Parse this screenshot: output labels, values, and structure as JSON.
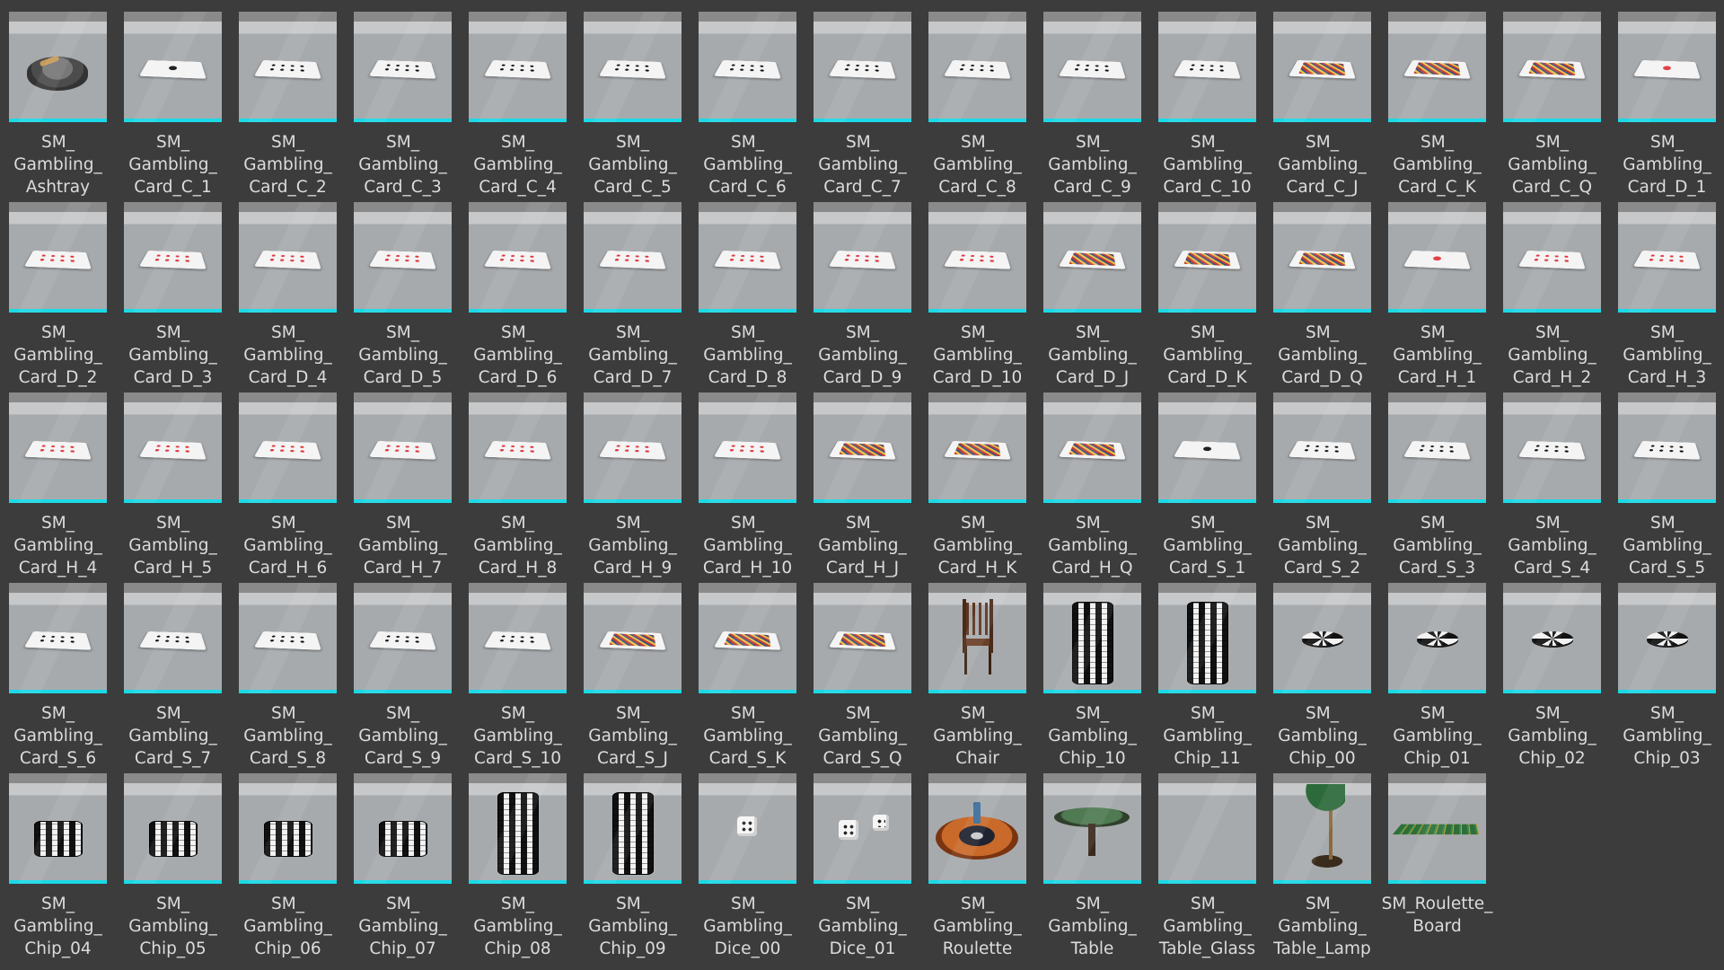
{
  "bar_color": "#1bd9e6",
  "background": "#3c3c3c",
  "assets": [
    {
      "label": "SM_\nGambling_\nAshtray",
      "icon": "ashtray"
    },
    {
      "label": "SM_\nGambling_\nCard_C_1",
      "icon": "card-club-ace"
    },
    {
      "label": "SM_\nGambling_\nCard_C_2",
      "icon": "card-club"
    },
    {
      "label": "SM_\nGambling_\nCard_C_3",
      "icon": "card-club"
    },
    {
      "label": "SM_\nGambling_\nCard_C_4",
      "icon": "card-club"
    },
    {
      "label": "SM_\nGambling_\nCard_C_5",
      "icon": "card-club"
    },
    {
      "label": "SM_\nGambling_\nCard_C_6",
      "icon": "card-club"
    },
    {
      "label": "SM_\nGambling_\nCard_C_7",
      "icon": "card-club"
    },
    {
      "label": "SM_\nGambling_\nCard_C_8",
      "icon": "card-club"
    },
    {
      "label": "SM_\nGambling_\nCard_C_9",
      "icon": "card-club"
    },
    {
      "label": "SM_\nGambling_\nCard_C_10",
      "icon": "card-club"
    },
    {
      "label": "SM_\nGambling_\nCard_C_J",
      "icon": "card-face"
    },
    {
      "label": "SM_\nGambling_\nCard_C_K",
      "icon": "card-face"
    },
    {
      "label": "SM_\nGambling_\nCard_C_Q",
      "icon": "card-face"
    },
    {
      "label": "SM_\nGambling_\nCard_D_1",
      "icon": "card-diamond-ace"
    },
    {
      "label": "SM_\nGambling_\nCard_D_2",
      "icon": "card-diamond"
    },
    {
      "label": "SM_\nGambling_\nCard_D_3",
      "icon": "card-diamond"
    },
    {
      "label": "SM_\nGambling_\nCard_D_4",
      "icon": "card-diamond"
    },
    {
      "label": "SM_\nGambling_\nCard_D_5",
      "icon": "card-diamond"
    },
    {
      "label": "SM_\nGambling_\nCard_D_6",
      "icon": "card-diamond"
    },
    {
      "label": "SM_\nGambling_\nCard_D_7",
      "icon": "card-diamond"
    },
    {
      "label": "SM_\nGambling_\nCard_D_8",
      "icon": "card-diamond"
    },
    {
      "label": "SM_\nGambling_\nCard_D_9",
      "icon": "card-diamond"
    },
    {
      "label": "SM_\nGambling_\nCard_D_10",
      "icon": "card-diamond"
    },
    {
      "label": "SM_\nGambling_\nCard_D_J",
      "icon": "card-face"
    },
    {
      "label": "SM_\nGambling_\nCard_D_K",
      "icon": "card-face"
    },
    {
      "label": "SM_\nGambling_\nCard_D_Q",
      "icon": "card-face"
    },
    {
      "label": "SM_\nGambling_\nCard_H_1",
      "icon": "card-heart-ace"
    },
    {
      "label": "SM_\nGambling_\nCard_H_2",
      "icon": "card-heart"
    },
    {
      "label": "SM_\nGambling_\nCard_H_3",
      "icon": "card-heart"
    },
    {
      "label": "SM_\nGambling_\nCard_H_4",
      "icon": "card-heart"
    },
    {
      "label": "SM_\nGambling_\nCard_H_5",
      "icon": "card-heart"
    },
    {
      "label": "SM_\nGambling_\nCard_H_6",
      "icon": "card-heart"
    },
    {
      "label": "SM_\nGambling_\nCard_H_7",
      "icon": "card-heart"
    },
    {
      "label": "SM_\nGambling_\nCard_H_8",
      "icon": "card-heart"
    },
    {
      "label": "SM_\nGambling_\nCard_H_9",
      "icon": "card-heart"
    },
    {
      "label": "SM_\nGambling_\nCard_H_10",
      "icon": "card-heart"
    },
    {
      "label": "SM_\nGambling_\nCard_H_J",
      "icon": "card-face"
    },
    {
      "label": "SM_\nGambling_\nCard_H_K",
      "icon": "card-face"
    },
    {
      "label": "SM_\nGambling_\nCard_H_Q",
      "icon": "card-face"
    },
    {
      "label": "SM_\nGambling_\nCard_S_1",
      "icon": "card-spade-ace"
    },
    {
      "label": "SM_\nGambling_\nCard_S_2",
      "icon": "card-spade"
    },
    {
      "label": "SM_\nGambling_\nCard_S_3",
      "icon": "card-spade"
    },
    {
      "label": "SM_\nGambling_\nCard_S_4",
      "icon": "card-spade"
    },
    {
      "label": "SM_\nGambling_\nCard_S_5",
      "icon": "card-spade"
    },
    {
      "label": "SM_\nGambling_\nCard_S_6",
      "icon": "card-spade"
    },
    {
      "label": "SM_\nGambling_\nCard_S_7",
      "icon": "card-spade"
    },
    {
      "label": "SM_\nGambling_\nCard_S_8",
      "icon": "card-spade"
    },
    {
      "label": "SM_\nGambling_\nCard_S_9",
      "icon": "card-spade"
    },
    {
      "label": "SM_\nGambling_\nCard_S_10",
      "icon": "card-spade"
    },
    {
      "label": "SM_\nGambling_\nCard_S_J",
      "icon": "card-face"
    },
    {
      "label": "SM_\nGambling_\nCard_S_K",
      "icon": "card-face"
    },
    {
      "label": "SM_\nGambling_\nCard_S_Q",
      "icon": "card-face"
    },
    {
      "label": "SM_\nGambling_\nChair",
      "icon": "chair"
    },
    {
      "label": "SM_\nGambling_\nChip_10",
      "icon": "chip-stack-tall"
    },
    {
      "label": "SM_\nGambling_\nChip_11",
      "icon": "chip-stack-tall"
    },
    {
      "label": "SM_\nGambling_\nChip_00",
      "icon": "chip"
    },
    {
      "label": "SM_\nGambling_\nChip_01",
      "icon": "chip"
    },
    {
      "label": "SM_\nGambling_\nChip_02",
      "icon": "chip"
    },
    {
      "label": "SM_\nGambling_\nChip_03",
      "icon": "chip"
    },
    {
      "label": "SM_\nGambling_\nChip_04",
      "icon": "chip-stack-short"
    },
    {
      "label": "SM_\nGambling_\nChip_05",
      "icon": "chip-stack-short"
    },
    {
      "label": "SM_\nGambling_\nChip_06",
      "icon": "chip-stack-short"
    },
    {
      "label": "SM_\nGambling_\nChip_07",
      "icon": "chip-stack-short"
    },
    {
      "label": "SM_\nGambling_\nChip_08",
      "icon": "chip-stack-tall"
    },
    {
      "label": "SM_\nGambling_\nChip_09",
      "icon": "chip-stack-tall"
    },
    {
      "label": "SM_\nGambling_\nDice_00",
      "icon": "dice-single"
    },
    {
      "label": "SM_\nGambling_\nDice_01",
      "icon": "dice-pair"
    },
    {
      "label": "SM_\nGambling_\nRoulette",
      "icon": "roulette"
    },
    {
      "label": "SM_\nGambling_\nTable",
      "icon": "table"
    },
    {
      "label": "SM_\nGambling_\nTable_Glass",
      "icon": "empty"
    },
    {
      "label": "SM_\nGambling_\nTable_Lamp",
      "icon": "lamp"
    },
    {
      "label": "SM_Roulette_\nBoard",
      "icon": "board"
    }
  ]
}
